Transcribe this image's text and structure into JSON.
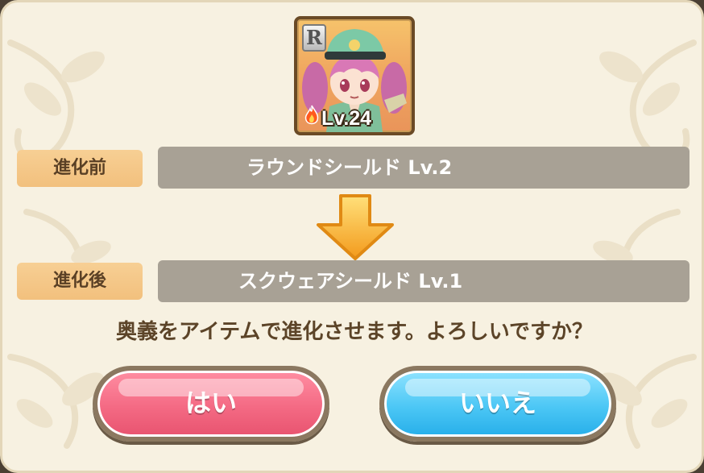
{
  "card": {
    "rarity": "R",
    "level_text": "Lv.24",
    "element_icon": "fire-icon"
  },
  "before": {
    "label": "進化前",
    "value": "ラウンドシールド Lv.2"
  },
  "after": {
    "label": "進化後",
    "value": "スクウェアシールド Lv.1"
  },
  "question": "奥義をアイテムで進化させます。よろしいですか？",
  "buttons": {
    "yes_label": "はい",
    "no_label": "いいえ"
  },
  "colors": {
    "panel": "#f7f1e1",
    "label_box": "#f2c07d",
    "value_box": "#a8a195",
    "yes": "#f46a84",
    "no": "#4cc7f5",
    "arrow": "#f7b52a"
  }
}
